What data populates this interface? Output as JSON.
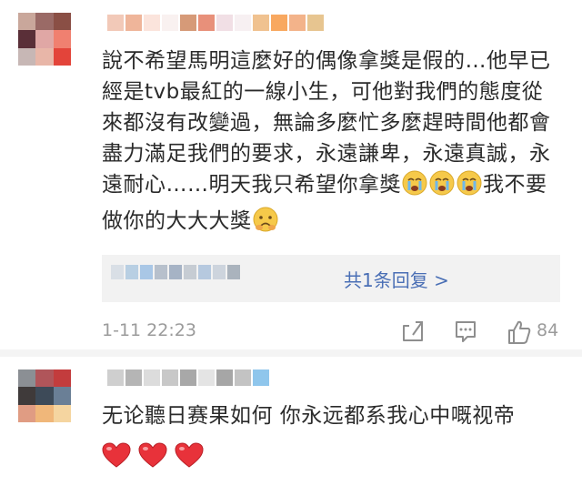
{
  "colors": {
    "link": "#4a6fb5",
    "meta": "#9b9b9b",
    "reply_bg": "#f2f2f2",
    "heart": "#e8323a"
  },
  "comments": [
    {
      "avatar_pixels": [
        "#c9a79b",
        "#9a6a66",
        "#8a4f45",
        "#5a2f38",
        "#e0a7a5",
        "#f08070",
        "#c7b7b5",
        "#e8b6a8",
        "#e3443a"
      ],
      "username_pixels": [
        "#f2c9b8",
        "#efb59a",
        "#fbe4dc",
        "#f9f1f0",
        "#d69a78",
        "#e8907a",
        "#f1dfe5",
        "#f7f0f2",
        "#f0c290",
        "#f8a860",
        "#f3b38a",
        "#e7c590"
      ],
      "text": "說不希望馬明這麼好的偶像拿獎是假的…他早已經是tvb最紅的一線小生，可他對我們的態度從來都沒有改變過，無論多麼忙多麼趕時間他都會盡力滿足我們的要求，永遠謙卑，永遠真誠，永遠耐心……明天我只希望你拿獎",
      "text_tail": "我不要做你的大大大獎",
      "emojis": [
        "crying-face-icon",
        "crying-face-icon",
        "crying-face-icon"
      ],
      "tail_emoji": "frowning-face-icon",
      "reply_link": "共1条回复 >",
      "reply_pixels": [
        "#d9dfe6",
        "#b8cfe3",
        "#a9c7e6",
        "#b7c0cc",
        "#a6b3c5",
        "#c6ccd3",
        "#b6c9df",
        "#cdd4dd",
        "#aab3bd"
      ],
      "timestamp": "1-11 22:23",
      "like_count": "84",
      "actions": [
        "share-icon",
        "comment-icon",
        "like-icon"
      ]
    },
    {
      "avatar_pixels": [
        "#8b8f94",
        "#b0555a",
        "#c33c3d",
        "#3f3a3a",
        "#3d4a58",
        "#6a7f96",
        "#e09c83",
        "#f0b77a",
        "#f5d5a0"
      ],
      "username_pixels": [
        "#cfcfcf",
        "#b5b5b5",
        "#dcdcdc",
        "#c8c8c8",
        "#a8a8a8",
        "#e4e4e4",
        "#a6a6a6",
        "#c3c3c3",
        "#8fc6ec"
      ],
      "text": "无论聽日赛果如何 你永远都系我心中嘅视帝",
      "hearts": [
        "heart-icon",
        "heart-icon",
        "heart-icon"
      ]
    }
  ]
}
